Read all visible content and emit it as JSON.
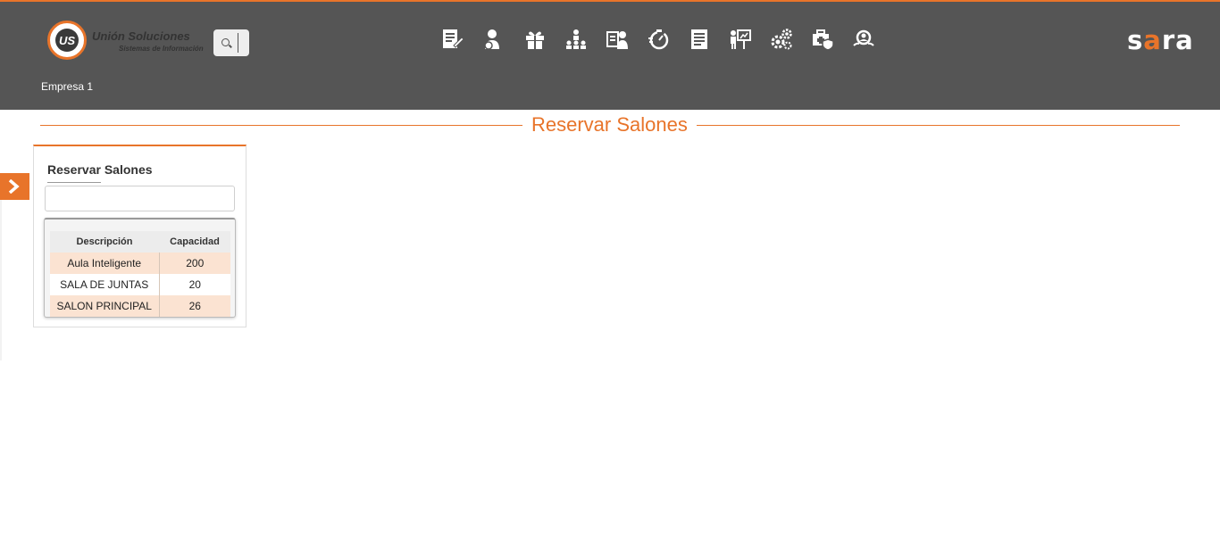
{
  "header": {
    "logo": {
      "name": "Unión Soluciones",
      "subtitle": "Sistemas de Información",
      "mark": "US"
    },
    "search": {
      "icon": "search-icon"
    },
    "nav_icons": [
      "document-edit-icon",
      "person-icon",
      "gift-icon",
      "hierarchy-icon",
      "id-badge-icon",
      "timer-icon",
      "report-icon",
      "presentation-icon",
      "gears-icon",
      "medical-case-icon",
      "search-person-icon"
    ],
    "brand": {
      "text_a": "s",
      "text_b": "a",
      "text_c": "ra"
    },
    "company": "Empresa 1",
    "accent_color": "#e8742a",
    "bar_color": "#555555"
  },
  "page": {
    "title": "Reservar Salones"
  },
  "sidebar_toggle": {
    "icon": "chevron-right-icon"
  },
  "panel": {
    "title": "Reservar Salones",
    "filter": {
      "value": "",
      "placeholder": ""
    },
    "table": {
      "columns": [
        "Descripción",
        "Capacidad"
      ],
      "rows": [
        {
          "descripcion": "Aula Inteligente",
          "capacidad": "200"
        },
        {
          "descripcion": "SALA DE JUNTAS",
          "capacidad": "20"
        },
        {
          "descripcion": "SALON PRINCIPAL",
          "capacidad": "26"
        }
      ]
    }
  }
}
